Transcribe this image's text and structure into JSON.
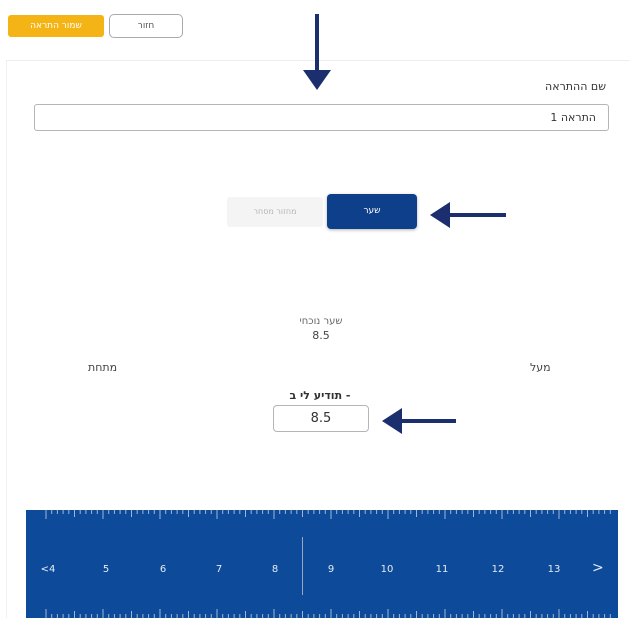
{
  "toolbar": {
    "save_alert_label": "שמור התראה",
    "back_label": "חזור"
  },
  "form": {
    "alert_name_label": "שם ההתראה",
    "alert_name_value": "התראה 1",
    "toggle": {
      "rate_label": "שער",
      "price_label": "מחזור מסחר",
      "selected": "rate"
    },
    "current_rate_label": "שער נוכחי",
    "current_rate_value": "8.5",
    "above_label": "מעל",
    "below_label": "מתחת",
    "notify_label": "תודיע לי ב -",
    "target_value": "8.5"
  },
  "ruler": {
    "labels": [
      "<4",
      "5",
      "6",
      "7",
      "8",
      "9",
      "10",
      "11",
      "12",
      "13"
    ],
    "right_arrow": ">",
    "color": "#0d4b9a"
  },
  "colors": {
    "accent": "#f5b415",
    "primary": "#0d3f8a",
    "annotation_arrow": "#1b2f6e"
  }
}
